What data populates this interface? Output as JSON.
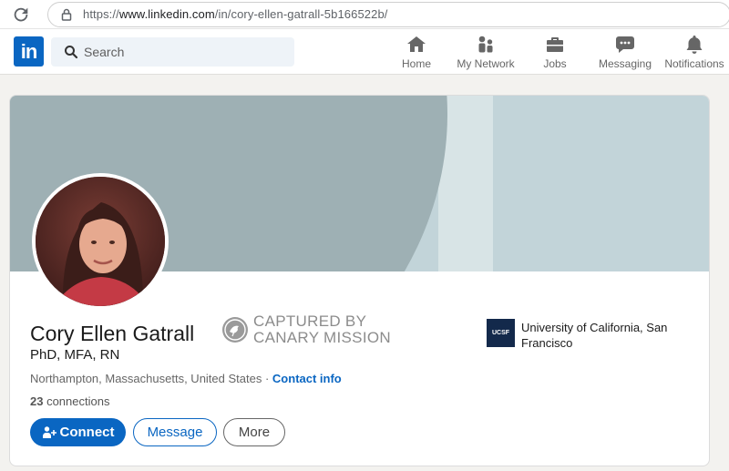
{
  "browser": {
    "url_prefix": "https://",
    "url_domain": "www.linkedin.com",
    "url_path": "/in/cory-ellen-gatrall-5b166522b/"
  },
  "nav": {
    "logo": "in",
    "search_placeholder": "Search",
    "items": [
      {
        "label": "Home",
        "icon": "home-icon"
      },
      {
        "label": "My Network",
        "icon": "network-icon"
      },
      {
        "label": "Jobs",
        "icon": "briefcase-icon"
      },
      {
        "label": "Messaging",
        "icon": "chat-icon"
      },
      {
        "label": "Notifications",
        "icon": "bell-icon"
      }
    ]
  },
  "profile": {
    "name": "Cory Ellen Gatrall",
    "headline": "PhD, MFA, RN",
    "location": "Northampton, Massachusetts, United States",
    "separator": " · ",
    "contact_label": "Contact info",
    "connections_count": "23",
    "connections_label": " connections"
  },
  "watermark": {
    "line1": "CAPTURED BY",
    "line2": "CANARY MISSION"
  },
  "education": {
    "logo_text": "UCSF",
    "name": "University of California, San Francisco"
  },
  "actions": {
    "connect": "Connect",
    "message": "Message",
    "more": "More"
  },
  "colors": {
    "brand": "#0a66c2",
    "banner_light": "#c2d4d9",
    "banner_dark": "#9eb0b4"
  }
}
